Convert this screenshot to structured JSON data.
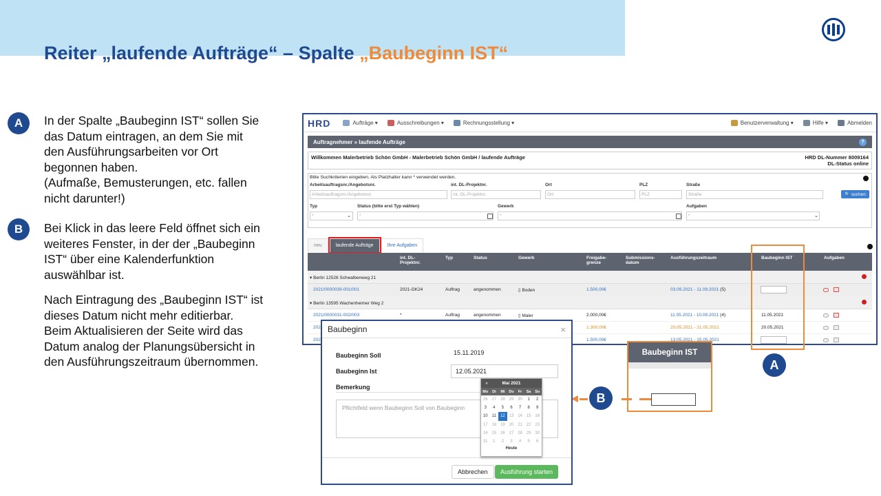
{
  "slide": {
    "title_main": "Reiter „laufende Aufträge“ – Spalte ",
    "title_accent": "„Baubeginn IST“",
    "bullet_a": "A",
    "bullet_b": "B",
    "para_a": [
      "In der Spalte „Baubeginn IST“ sollen Sie",
      "das Datum eintragen, an dem Sie mit",
      "den Ausführungsarbeiten vor Ort",
      "begonnen haben.",
      "(Aufmaße, Bemusterungen, etc. fallen",
      "nicht darunter!)"
    ],
    "para_b1": [
      "Bei Klick in das leere Feld öffnet sich ein",
      "weiteres Fenster, in der der „Baubeginn",
      "IST“ über eine Kalenderfunktion",
      "auswählbar ist."
    ],
    "para_b2": [
      "Nach Eintragung des „Baubeginn IST“ ist",
      "dieses Datum nicht mehr editierbar.",
      "Beim Aktualisieren der Seite wird das",
      "Datum analog der Planungsübersicht in",
      "den Ausführungszeitraum übernommen."
    ],
    "callout_a": "A",
    "callout_b": "B",
    "zoom_header": "Baubeginn IST",
    "accent_color": "#ee8a3c",
    "brand_color": "#1f4a8f"
  },
  "app": {
    "brand": "HRD",
    "nav": [
      {
        "label": "Aufträge ▾",
        "icon": "orders-icon"
      },
      {
        "label": "Ausschreibungen ▾",
        "icon": "tenders-icon"
      },
      {
        "label": "Rechnungsstellung ▾",
        "icon": "invoice-icon"
      }
    ],
    "nav_right": [
      {
        "label": "Benutzerverwaltung ▾",
        "icon": "users-icon"
      },
      {
        "label": "Hilfe ▾",
        "icon": "help-icon"
      },
      {
        "label": "Abmelden",
        "icon": "logout-icon"
      }
    ],
    "breadcrumb": "Auftragnehmer » laufende Aufträge",
    "help_glyph": "?",
    "welcome": "Willkommen Malerbetrieb Schön GmbH - Malerbetrieb Schön GmbH / laufende Aufträge",
    "dl_number": "HRD DL-Nummer 8009164",
    "dl_status": "DL-Status online",
    "search": {
      "hint": "Bitte Suchkriterien eingeben. Als Platzhalter kann * verwendet werden.",
      "labels": {
        "auftrag": "Arbeitsauftragsnr./Angebotsnr.",
        "projekt": "int. DL-Projektnr.",
        "ort": "Ort",
        "plz": "PLZ",
        "strasse": "Straße",
        "typ": "Typ",
        "status": "Status (bitte erst Typ wählen)",
        "gewerk": "Gewerk",
        "aufgaben": "Aufgaben"
      },
      "placeholders": {
        "auftrag": "Arbeitsauftragsnr./Angebotsnr.",
        "projekt": "int. DL-Projektnr.",
        "ort": "Ort",
        "plz": "PLZ",
        "strasse": "Straße",
        "star": "*"
      },
      "button": "suchen"
    },
    "tabs": [
      "neu",
      "laufende Aufträge",
      "Ihre Aufgaben"
    ],
    "columns": {
      "projekt": "int. DL-\nProjektnr.",
      "typ": "Typ",
      "status": "Status",
      "gewerk": "Gewerk",
      "freigabe": "Freigabe-\ngrenze",
      "submission": "Submissions-\ndatum",
      "ausfuehrung": "Ausführungszeitraum",
      "baubeginn": "Baubeginn IST",
      "aufgaben": "Aufgaben"
    },
    "group1": "▾ Berlin 12526 Schwalbenweg 21",
    "group2": "▾ Berlin 13595 Wachenheimer Weg 2",
    "rows": [
      {
        "nr": "2021/0000039-001/001",
        "projekt": "2021-GK24",
        "typ": "Auftrag",
        "status": "angenommen",
        "gewerk": "Boden",
        "freigabe": "1.500,00€",
        "zeitraum": "03.09.2021 - 11.09.2021",
        "tage": "(5)",
        "baubeginn": ""
      },
      {
        "nr": "2021/0000031-002/003",
        "projekt": "*",
        "typ": "Auftrag",
        "status": "angenommen",
        "gewerk": "Maler",
        "freigabe": "2.000,00€",
        "zeitraum": "11.05.2021 - 10.09.2021",
        "tage": "(4)",
        "baubeginn": "11.05.2021"
      },
      {
        "nr": "202",
        "freigabe": "1.300,00€",
        "zeitraum": "20.05.2021 - 21.05.2021",
        "baubeginn": "20.05.2021"
      },
      {
        "nr": "202",
        "freigabe": "1.500,00€",
        "zeitraum": "13.05.2021 - 15.05.2021",
        "baubeginn": ""
      }
    ]
  },
  "modal": {
    "title": "Baubeginn",
    "close": "×",
    "soll_label": "Baubeginn Soll",
    "soll_value": "15.11.2019",
    "ist_label": "Baubeginn Ist",
    "ist_value": "12.05.2021",
    "bemerkung_label": "Bemerkung",
    "bemerkung_placeholder": "Pflichtfeld wenn Baubeginn Soll von Baubeginn",
    "cancel": "Abbrechen",
    "start": "Ausführung starten"
  },
  "calendar": {
    "prev": "«",
    "month": "Mai 2021",
    "dow": [
      "Mo",
      "Di",
      "Mi",
      "Do",
      "Fr",
      "Sa",
      "So"
    ],
    "weeks": [
      [
        "26",
        "27",
        "28",
        "29",
        "30",
        "1",
        "2"
      ],
      [
        "3",
        "4",
        "5",
        "6",
        "7",
        "8",
        "9"
      ],
      [
        "10",
        "11",
        "12",
        "13",
        "14",
        "15",
        "16"
      ],
      [
        "17",
        "18",
        "19",
        "20",
        "21",
        "22",
        "23"
      ],
      [
        "24",
        "25",
        "26",
        "27",
        "28",
        "29",
        "30"
      ],
      [
        "31",
        "1",
        "2",
        "3",
        "4",
        "5",
        "6"
      ]
    ],
    "selected": "12",
    "today": "Heute"
  }
}
